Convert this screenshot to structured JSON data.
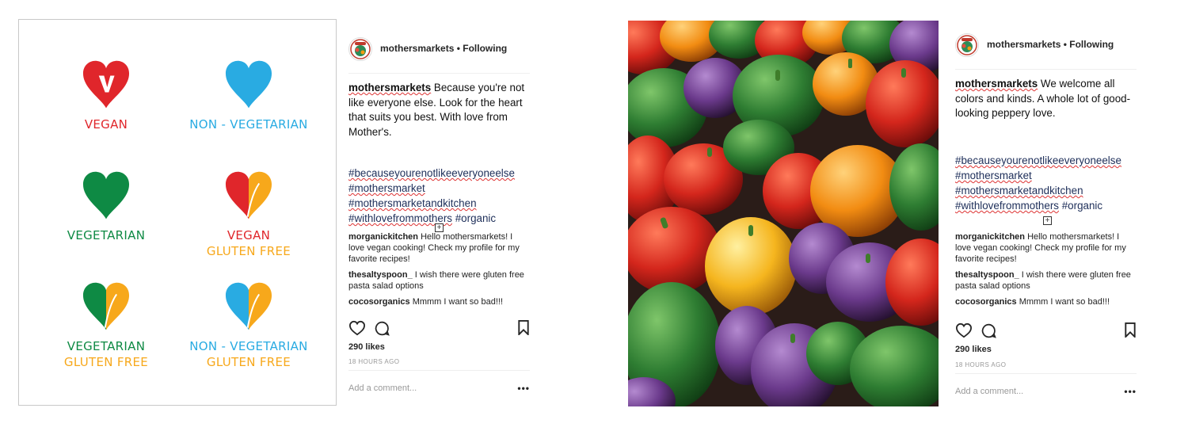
{
  "post1": {
    "legend": [
      {
        "label_line1": "VEGAN",
        "label_line2": "",
        "left_color": "#e0262b",
        "right_color": "#e0262b",
        "line1_color": "#e0262b",
        "line2_color": "",
        "badge": "V"
      },
      {
        "label_line1": "NON - VEGETARIAN",
        "label_line2": "",
        "left_color": "#29abe2",
        "right_color": "#29abe2",
        "line1_color": "#29abe2",
        "line2_color": "",
        "badge": ""
      },
      {
        "label_line1": "VEGETARIAN",
        "label_line2": "",
        "left_color": "#0e8a44",
        "right_color": "#0e8a44",
        "line1_color": "#0e8a44",
        "line2_color": "",
        "badge": ""
      },
      {
        "label_line1": "VEGAN",
        "label_line2": "GLUTEN FREE",
        "left_color": "#e0262b",
        "right_color": "#f7a81b",
        "line1_color": "#e0262b",
        "line2_color": "#f7a81b",
        "badge": ""
      },
      {
        "label_line1": "VEGETARIAN",
        "label_line2": "GLUTEN FREE",
        "left_color": "#0e8a44",
        "right_color": "#f7a81b",
        "line1_color": "#0e8a44",
        "line2_color": "#f7a81b",
        "badge": ""
      },
      {
        "label_line1": "NON - VEGETARIAN",
        "label_line2": "GLUTEN FREE",
        "left_color": "#29abe2",
        "right_color": "#f7a81b",
        "line1_color": "#29abe2",
        "line2_color": "#f7a81b",
        "badge": ""
      }
    ],
    "header": {
      "username": "mothersmarkets",
      "separator": "•",
      "status": "Following"
    },
    "caption": {
      "username": "mothersmarkets",
      "text": " Because you're not like everyone else. Look for the heart that suits you best. With love from Mother's."
    },
    "hashtags": [
      "#becauseyourenotlikeeveryoneelse",
      "#mothersmarket",
      "#mothersmarketandkitchen",
      "#withlovefrommothers",
      "#organic"
    ],
    "comments": [
      {
        "user": "morganickitchen",
        "text": " Hello mothersmarkets! I love vegan cooking! Check my profile for my favorite recipes!"
      },
      {
        "user": "thesaltyspoon_",
        "text": " I wish there were gluten free pasta salad options"
      },
      {
        "user": "cocosorganics",
        "text": " Mmmm I want so bad!!!"
      }
    ],
    "likes": "290 likes",
    "time": "18 HOURS AGO",
    "add_comment_placeholder": "Add a comment...",
    "more": "•••"
  },
  "post2": {
    "header": {
      "username": "mothersmarkets",
      "separator": "•",
      "status": "Following"
    },
    "caption": {
      "username": "mothersmarkets",
      "text": " We welcome all colors and kinds. A whole lot of good-looking peppery love."
    },
    "hashtags": [
      "#becauseyourenotlikeeveryoneelse",
      "#mothersmarket",
      "#mothersmarketandkitchen",
      "#withlovefrommothers",
      "#organic"
    ],
    "comments": [
      {
        "user": "morganickitchen",
        "text": " Hello mothersmarkets! I love vegan cooking! Check my profile for my favorite recipes!"
      },
      {
        "user": "thesaltyspoon_",
        "text": " I wish there were gluten free pasta salad options"
      },
      {
        "user": "cocosorganics",
        "text": " Mmmm I want so bad!!!"
      }
    ],
    "likes": "290 likes",
    "time": "18 HOURS AGO",
    "add_comment_placeholder": "Add a comment...",
    "more": "•••"
  },
  "icons": {
    "like": "heart-outline-icon",
    "comment": "speech-bubble-icon",
    "save": "bookmark-icon",
    "expand": "plus-box-icon"
  }
}
